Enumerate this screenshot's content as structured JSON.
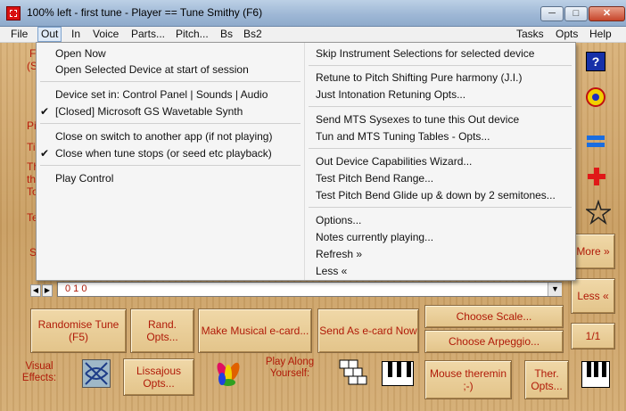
{
  "window": {
    "title": "100% left - first tune - Player == Tune Smithy (F6)",
    "minimize_label": "─",
    "maximize_label": "□",
    "close_label": "✕"
  },
  "menubar": {
    "items": [
      "File",
      "Out",
      "In",
      "Voice",
      "Parts...",
      "Pitch...",
      "Bs",
      "Bs2"
    ],
    "right_items": [
      "Tasks",
      "Opts",
      "Help"
    ],
    "active": "Out"
  },
  "dropdown": {
    "left": [
      {
        "label": "Open Now",
        "checked": false
      },
      {
        "label": "Open Selected Device at start of session",
        "checked": false
      },
      {
        "separator": true
      },
      {
        "label": "Device set in: Control Panel | Sounds | Audio",
        "checked": false
      },
      {
        "label": "[Closed] Microsoft GS Wavetable Synth",
        "checked": true
      },
      {
        "separator": true
      },
      {
        "label": "Close on switch to another app (if not playing)",
        "checked": false
      },
      {
        "label": "Close when tune stops (or seed etc playback)",
        "checked": true
      },
      {
        "separator": true
      },
      {
        "label": "Play Control",
        "checked": false
      }
    ],
    "right": [
      {
        "label": "Skip Instrument Selections for selected device"
      },
      {
        "separator": true
      },
      {
        "label": "Retune to Pitch Shifting Pure harmony (J.I.)"
      },
      {
        "label": "Just Intonation Retuning Opts..."
      },
      {
        "separator": true
      },
      {
        "label": "Send MTS Sysexes to tune this Out device"
      },
      {
        "label": "Tun and MTS Tuning Tables - Opts..."
      },
      {
        "separator": true
      },
      {
        "label": "Out Device Capabilities Wizard..."
      },
      {
        "label": "Test Pitch Bend Range..."
      },
      {
        "label": "Test Pitch Bend Glide up & down by 2 semitones..."
      },
      {
        "separator": true
      },
      {
        "label": "Options..."
      },
      {
        "label": "Notes currently playing..."
      },
      {
        "label": "Refresh »"
      },
      {
        "label": "Less «"
      }
    ]
  },
  "background_left_fragments": [
    "F",
    "(S",
    "Pi",
    "Ti",
    "Th",
    "th",
    "To",
    "Te",
    "S"
  ],
  "combo": {
    "value": "0 1 0"
  },
  "side_buttons": {
    "more": "More »",
    "less": "Less «",
    "page": "1/1"
  },
  "bottom": {
    "randomise": "Randomise Tune (F5)",
    "rand_opts": "Rand. Opts...",
    "make_musical": "Make Musical e-card...",
    "send_ecard": "Send As e-card Now",
    "choose_scale": "Choose Scale...",
    "choose_arpeggio": "Choose Arpeggio...",
    "visual_effects": "Visual Effects:",
    "lissajous": "Lissajous Opts...",
    "play_along": "Play Along Yourself:",
    "mouse_theremin": "Mouse theremin ;-)",
    "ther_opts": "Ther. Opts..."
  },
  "icons": [
    "help-icon",
    "target-icon",
    "equals-icon",
    "plus-icon",
    "star-icon",
    "lissajous-icon",
    "flower-icon",
    "steps-icon",
    "piano-icon"
  ],
  "colors": {
    "accent_text": "#b01a08",
    "wood": "#c99e62",
    "menu_bg": "#f5f5f5"
  }
}
